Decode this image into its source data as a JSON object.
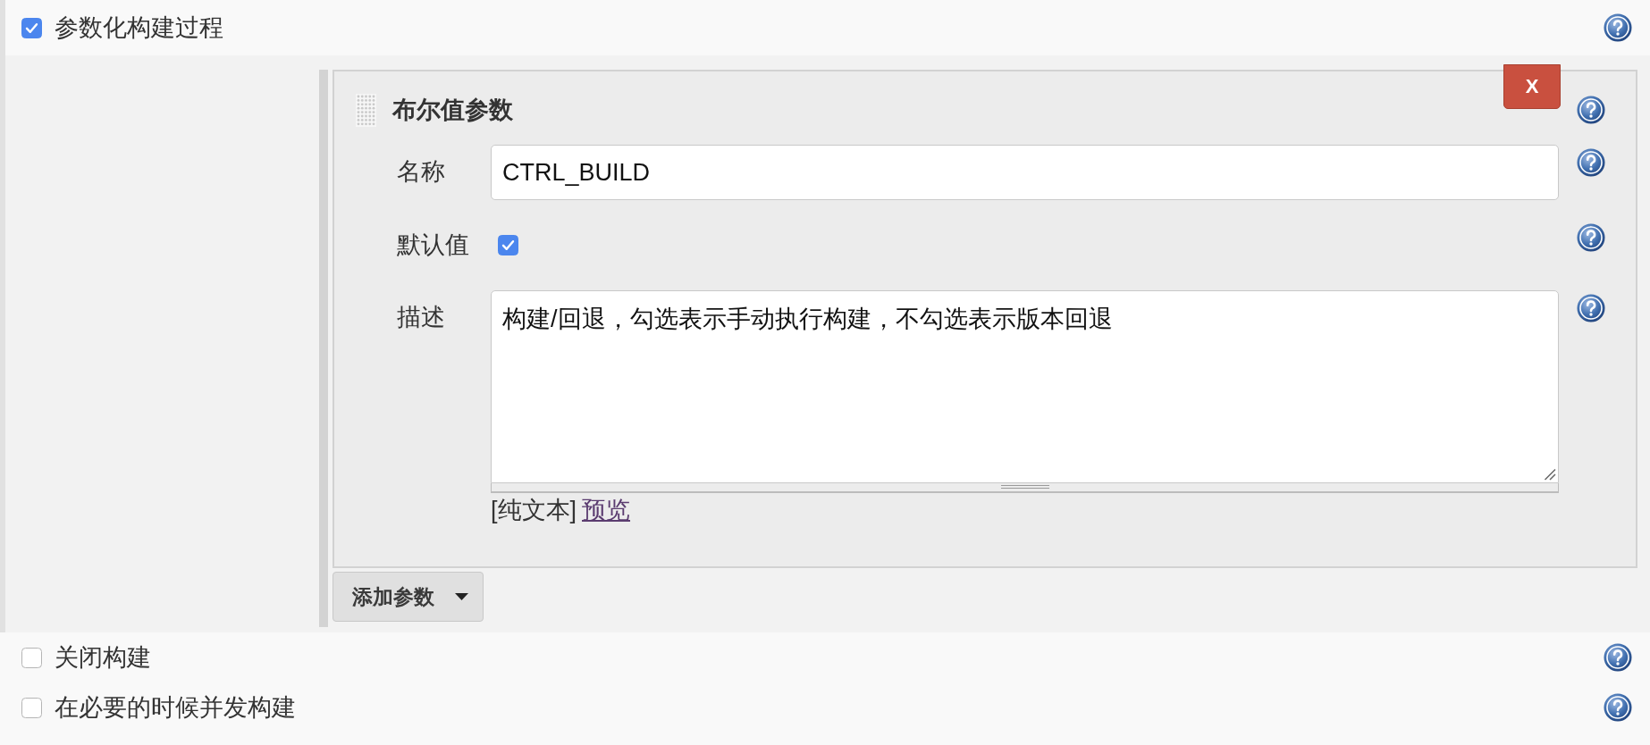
{
  "parameterized_build": {
    "label": "参数化构建过程",
    "checked": true,
    "parameters": [
      {
        "title": "布尔值参数",
        "delete_button": "X",
        "fields": [
          {
            "kind": "text",
            "label": "名称",
            "value": "CTRL_BUILD"
          },
          {
            "kind": "checkbox",
            "label": "默认值",
            "checked": true
          },
          {
            "kind": "textarea",
            "label": "描述",
            "value": "构建/回退，勾选表示手动执行构建，不勾选表示版本回退",
            "format": "[纯文本]",
            "preview_link": "预览"
          }
        ]
      }
    ],
    "add_button": "添加参数"
  },
  "options": [
    {
      "label": "关闭构建",
      "checked": false
    },
    {
      "label": "在必要的时候并发构建",
      "checked": false
    }
  ]
}
